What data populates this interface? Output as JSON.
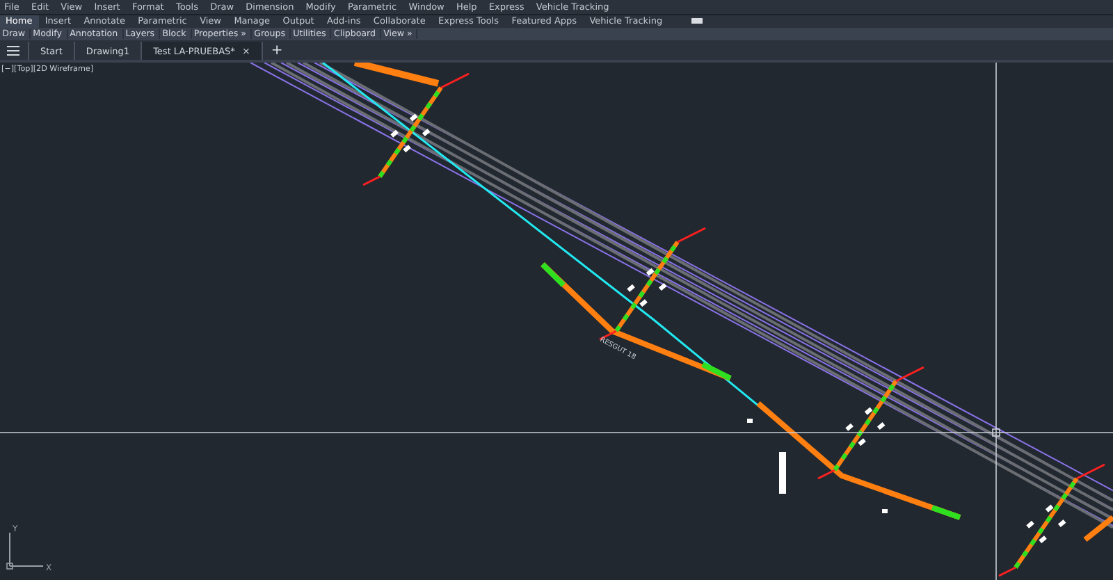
{
  "menu_bar": [
    "File",
    "Edit",
    "View",
    "Insert",
    "Format",
    "Tools",
    "Draw",
    "Dimension",
    "Modify",
    "Parametric",
    "Window",
    "Help",
    "Express",
    "Vehicle Tracking"
  ],
  "ribbon_tabs": [
    {
      "label": "Home",
      "selected": true
    },
    {
      "label": "Insert",
      "selected": false
    },
    {
      "label": "Annotate",
      "selected": false
    },
    {
      "label": "Parametric",
      "selected": false
    },
    {
      "label": "View",
      "selected": false
    },
    {
      "label": "Manage",
      "selected": false
    },
    {
      "label": "Output",
      "selected": false
    },
    {
      "label": "Add-ins",
      "selected": false
    },
    {
      "label": "Collaborate",
      "selected": false
    },
    {
      "label": "Express Tools",
      "selected": false
    },
    {
      "label": "Featured Apps",
      "selected": false
    },
    {
      "label": "Vehicle Tracking",
      "selected": false
    }
  ],
  "ribbon_panels": [
    "Draw",
    "Modify",
    "Annotation",
    "Layers",
    "Block",
    "Properties »",
    "Groups",
    "Utilities",
    "Clipboard",
    "View »"
  ],
  "document_tabs": [
    {
      "label": "Start",
      "selected": false
    },
    {
      "label": "Drawing1",
      "selected": false
    },
    {
      "label": "Test LA-PRUEBAS*",
      "selected": true
    }
  ],
  "close_glyph": "×",
  "new_tab_glyph": "+",
  "viewport": {
    "label": "[−][Top][2D Wireframe]",
    "annotation": "RESGUT 18",
    "ucs_x": "X",
    "ucs_y": "Y"
  }
}
